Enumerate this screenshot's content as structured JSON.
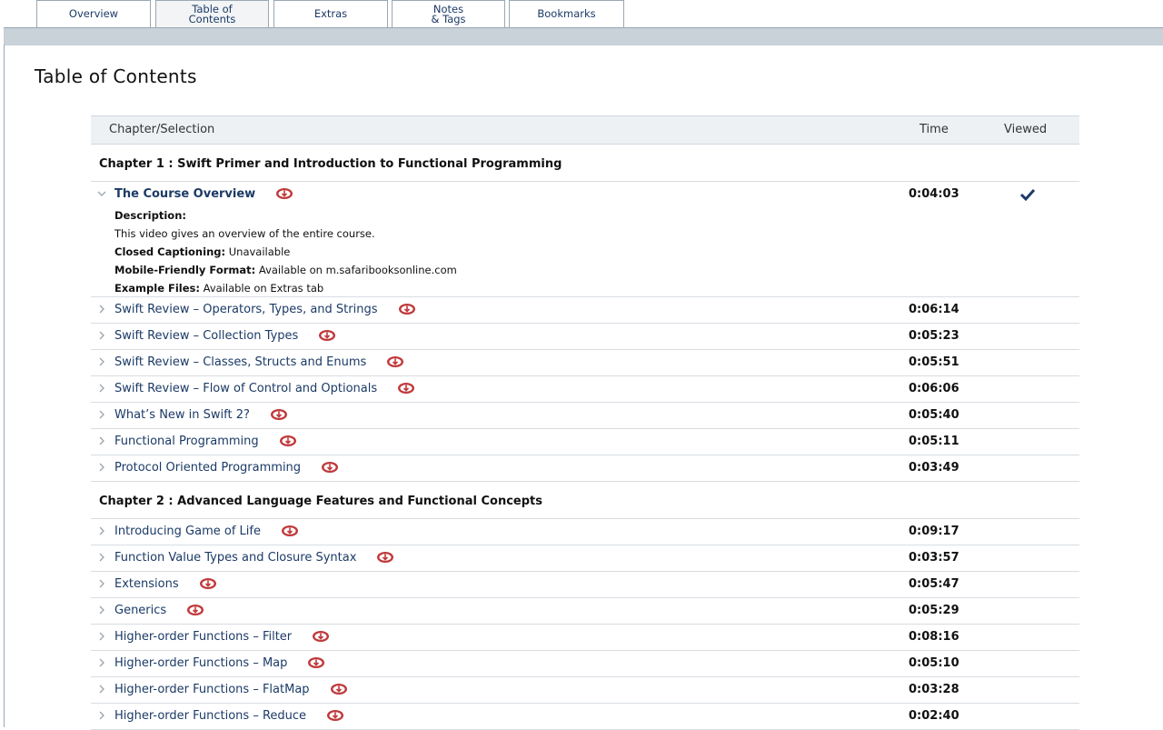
{
  "tabs": [
    {
      "label": "Overview",
      "active": false
    },
    {
      "label": "Table of\nContents",
      "active": true
    },
    {
      "label": "Extras",
      "active": false
    },
    {
      "label": "Notes\n& Tags",
      "active": false
    },
    {
      "label": "Bookmarks",
      "active": false
    }
  ],
  "page_title": "Table of Contents",
  "table": {
    "headers": {
      "chapter": "Chapter/Selection",
      "time": "Time",
      "viewed": "Viewed"
    },
    "chapters": [
      {
        "title": "Chapter 1 : Swift Primer and Introduction to Functional Programming",
        "items": [
          {
            "title": "The Course Overview",
            "time": "0:04:03",
            "viewed": true,
            "expanded": true,
            "details": {
              "description_label": "Description:",
              "description": "This video gives an overview of the entire course.",
              "cc_label": "Closed Captioning:",
              "cc_value": "Unavailable",
              "mobile_label": "Mobile-Friendly Format:",
              "mobile_value": "Available on m.safaribooksonline.com",
              "files_label": "Example Files:",
              "files_value": "Available on Extras tab"
            }
          },
          {
            "title": "Swift Review – Operators, Types, and Strings",
            "time": "0:06:14"
          },
          {
            "title": "Swift Review – Collection Types",
            "time": "0:05:23"
          },
          {
            "title": "Swift Review – Classes, Structs and Enums",
            "time": "0:05:51"
          },
          {
            "title": "Swift Review – Flow of Control and Optionals",
            "time": "0:06:06"
          },
          {
            "title": "What’s New in Swift 2?",
            "time": "0:05:40"
          },
          {
            "title": "Functional Programming",
            "time": "0:05:11"
          },
          {
            "title": "Protocol Oriented Programming",
            "time": "0:03:49"
          }
        ]
      },
      {
        "title": "Chapter 2 : Advanced Language Features and Functional Concepts",
        "items": [
          {
            "title": "Introducing Game of Life",
            "time": "0:09:17"
          },
          {
            "title": "Function Value Types and Closure Syntax",
            "time": "0:03:57"
          },
          {
            "title": "Extensions",
            "time": "0:05:47"
          },
          {
            "title": "Generics",
            "time": "0:05:29"
          },
          {
            "title": "Higher-order Functions – Filter",
            "time": "0:08:16"
          },
          {
            "title": "Higher-order Functions – Map",
            "time": "0:05:10"
          },
          {
            "title": "Higher-order Functions – FlatMap",
            "time": "0:03:28"
          },
          {
            "title": "Higher-order Functions – Reduce",
            "time": "0:02:40"
          }
        ]
      }
    ]
  },
  "colors": {
    "link": "#1b3a66",
    "download_icon": "#c0393b",
    "check": "#1b3a66"
  },
  "icons": {
    "download": "cloud-download-icon",
    "expand": "chevron-right-icon",
    "collapse": "chevron-down-icon",
    "viewed": "checkmark-icon"
  }
}
